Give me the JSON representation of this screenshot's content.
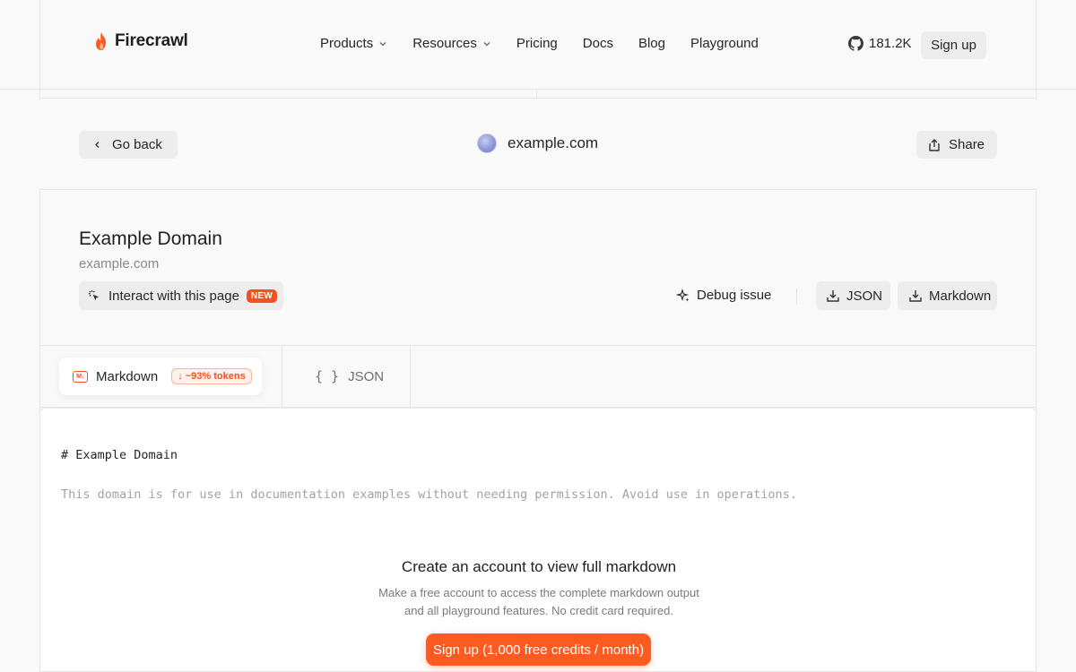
{
  "brand": {
    "name": "Firecrawl",
    "accent": "#ff5a1f"
  },
  "nav": {
    "links": [
      {
        "label": "Products",
        "dropdown": true
      },
      {
        "label": "Resources",
        "dropdown": true
      },
      {
        "label": "Pricing",
        "dropdown": false
      },
      {
        "label": "Docs",
        "dropdown": false
      },
      {
        "label": "Blog",
        "dropdown": false
      },
      {
        "label": "Playground",
        "dropdown": false
      }
    ],
    "github_stars": "181.2K",
    "signup_label": "Sign up"
  },
  "header": {
    "back_label": "Go back",
    "site": "example.com",
    "share_label": "Share"
  },
  "page": {
    "title": "Example Domain",
    "url": "example.com",
    "interact_label": "Interact with this page",
    "new_badge": "NEW",
    "debug_label": "Debug issue",
    "json_label": "JSON",
    "markdown_label": "Markdown"
  },
  "tabs": {
    "markdown_label": "Markdown",
    "markdown_icon_text": "M↓",
    "token_badge": "↓ ~93% tokens",
    "json_label": "JSON",
    "json_icon": "{ }"
  },
  "content": {
    "heading_line": "# Example Domain",
    "body_line": "This domain is for use in documentation examples without needing permission. Avoid use in operations.",
    "cta_title": "Create an account to view full markdown",
    "cta_desc_line1": "Make a free account to access the complete markdown output",
    "cta_desc_line2": "and all playground features. No credit card required.",
    "cta_button": "Sign up (1,000 free credits / month)"
  }
}
